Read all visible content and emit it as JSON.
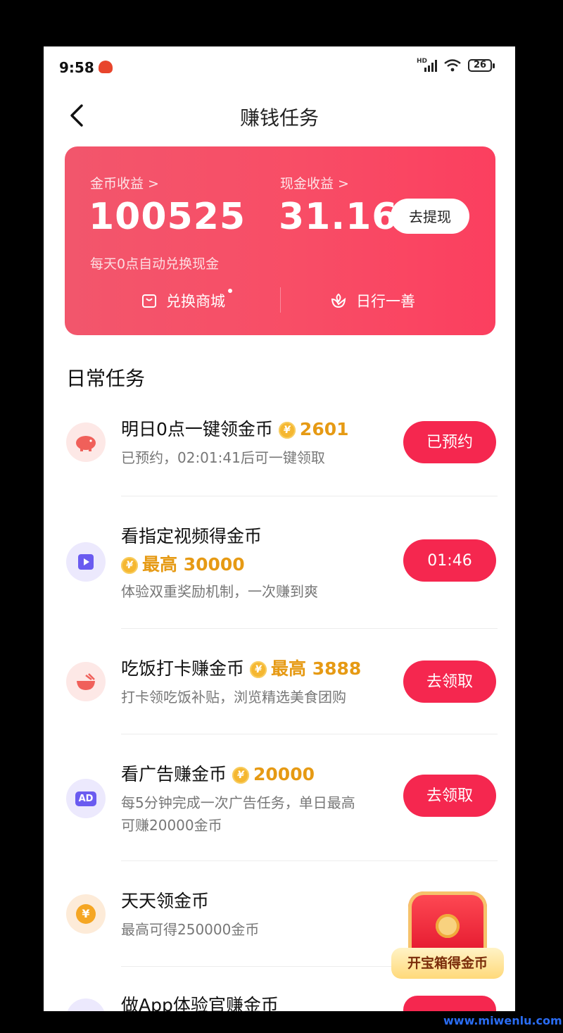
{
  "status_bar": {
    "time": "9:58",
    "hd": "HD",
    "battery": "26"
  },
  "nav": {
    "title": "赚钱任务"
  },
  "earnings": {
    "coin_label": "金币收益 >",
    "coin_value": "100525",
    "cash_label": "现金收益 >",
    "cash_value": "31.16",
    "withdraw_label": "去提现",
    "note": "每天0点自动兑换现金",
    "mall_label": "兑换商城",
    "charity_label": "日行一善"
  },
  "section_title": "日常任务",
  "tasks": [
    {
      "name": "明日0点一键领金币",
      "reward": "2601",
      "desc": "已预约，02:01:41后可一键领取",
      "button": "已预约",
      "icon": "piggy-bank-icon"
    },
    {
      "name": "看指定视频得金币",
      "reward": "最高 30000",
      "desc": "体验双重奖励机制，一次赚到爽",
      "button": "01:46",
      "icon": "video-icon"
    },
    {
      "name": "吃饭打卡赚金币",
      "reward": "最高 3888",
      "desc": "打卡领吃饭补贴，浏览精选美食团购",
      "button": "去领取",
      "icon": "bowl-icon"
    },
    {
      "name": "看广告赚金币",
      "reward": "20000",
      "desc_line1": "每5分钟完成一次广告任务，单日最高",
      "desc_line2": "可赚20000金币",
      "button": "去领取",
      "icon": "ad-icon",
      "icon_text": "AD"
    },
    {
      "name": "天天领金币",
      "desc": "最高可得250000金币",
      "icon": "yen-coin-icon",
      "icon_text": "¥"
    },
    {
      "name": "做App体验官赚金币",
      "icon": "app-icon"
    }
  ],
  "treasure": {
    "label": "开宝箱得金币"
  },
  "coin_symbol": "¥",
  "watermark": "www.miwenlu.com",
  "colors": {
    "card": "#f84d66",
    "button": "#f5274f",
    "reward": "#e69a14"
  }
}
